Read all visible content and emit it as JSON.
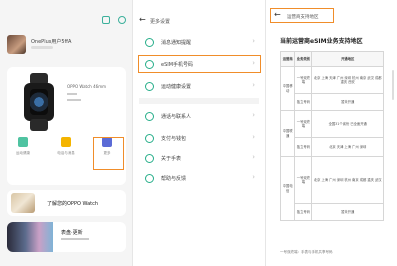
{
  "colors": {
    "accent": "#f08d2a",
    "brand_green": "#27ae8a"
  },
  "home": {
    "user_name": "OnePlus用户5ffA",
    "device": {
      "name": "OPPO Watch 46mm"
    },
    "tiles": [
      {
        "label": "运动健康",
        "icon": "health-icon",
        "color": "#4fc3a1"
      },
      {
        "label": "电话与消息",
        "icon": "phone-icon",
        "color": "#f4b400"
      },
      {
        "label": "更多",
        "icon": "grid-icon",
        "color": "#5b6bd6"
      }
    ],
    "promos": [
      {
        "title": "了解您的OPPO Watch"
      },
      {
        "title": "表盘·更新"
      }
    ]
  },
  "settings": {
    "title": "更多设置",
    "items": [
      {
        "label": "消息通知提醒",
        "icon": "bell-icon"
      },
      {
        "label": "eSIM手机号码",
        "icon": "sim-icon"
      },
      {
        "label": "运动健康设置",
        "icon": "run-icon"
      },
      {
        "label": "通话与联系人",
        "icon": "contact-icon"
      },
      {
        "label": "支付与钱包",
        "icon": "wallet-icon"
      },
      {
        "label": "关于手表",
        "icon": "info-icon"
      },
      {
        "label": "帮助与反馈",
        "icon": "help-icon"
      }
    ]
  },
  "support": {
    "title": "运营商支持地区",
    "heading": "当前运营商eSIM业务支持地区",
    "columns": [
      "运营商",
      "业务类别",
      "开通地区"
    ],
    "rows": [
      {
        "carrier": "中国移动",
        "type": "一号双终端",
        "regions": "北京 上海 天津 广州 深圳 杭州 南京 武汉 成都 重庆 西安"
      },
      {
        "carrier": "",
        "type": "独立号码",
        "regions": "暂未开通"
      },
      {
        "carrier": "中国联通",
        "type": "一号双终端",
        "regions": "全国31个省份 已全面开通"
      },
      {
        "carrier": "",
        "type": "独立号码",
        "regions": "北京 天津 上海 广州 深圳"
      },
      {
        "carrier": "中国电信",
        "type": "一号双终端",
        "regions": "北京 上海 广州 深圳 杭州 南京 成都 重庆 武汉"
      },
      {
        "carrier": "",
        "type": "独立号码",
        "regions": "暂未开通"
      }
    ],
    "footnote": "一号双终端：手表与手机共享号码"
  }
}
